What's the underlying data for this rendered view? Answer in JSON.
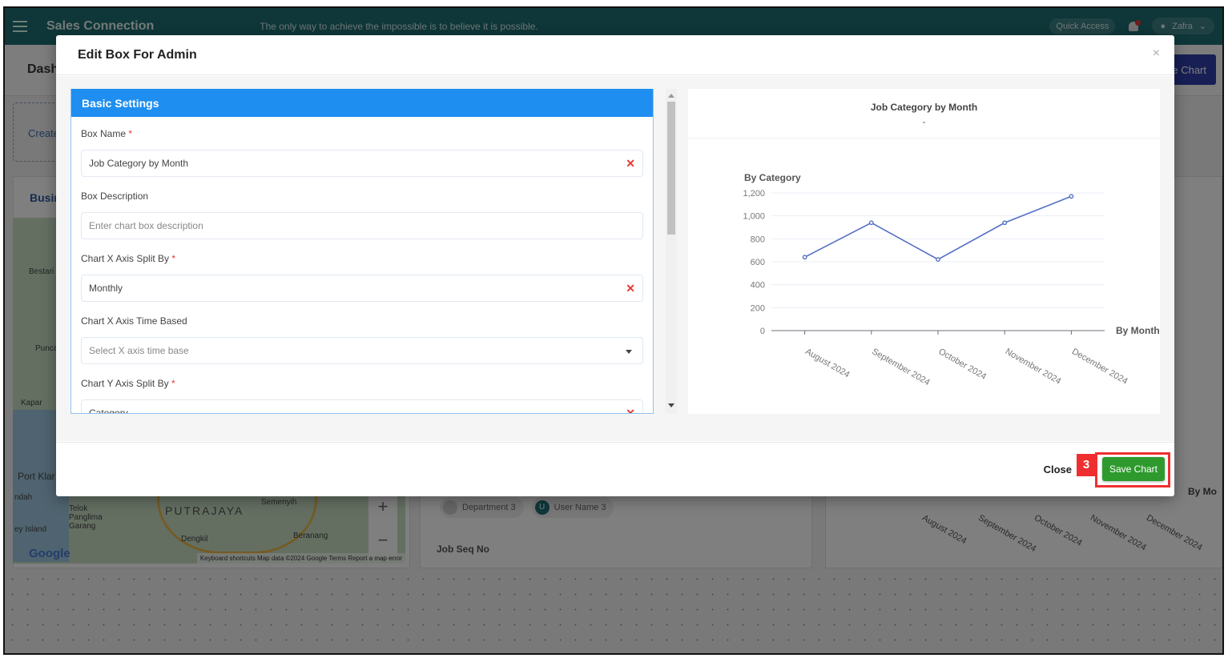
{
  "app": {
    "brand": "Sales Connection",
    "quote": "The only way to achieve the impossible is to believe it is possible.",
    "quick_access": "Quick Access",
    "user_name": "Zafra",
    "page_title": "Dash",
    "create_chart_button": "e Chart",
    "create_box": "Create",
    "business_panel_title": "Busine",
    "map_labels": [
      "Bestari J",
      "Punca",
      "Kapar",
      "Port Klar",
      "ndah",
      "Telok Panglima Garang",
      "PUTRAJAYA",
      "Dengkil",
      "Beranang",
      "Semenyih",
      "ey Island"
    ],
    "map_footer": "Keyboard shortcuts   Map data ©2024 Google   Terms   Report a map error",
    "google": "Google",
    "chips": [
      "Department 3",
      "User Name 3"
    ],
    "user_chip_initial": "U",
    "job_seq_no": "Job Seq No",
    "bg_chart_axis": [
      "August 2024",
      "September 2024",
      "October 2024",
      "November 2024",
      "December 2024"
    ],
    "bg_chart_xlabel": "By Mo"
  },
  "modal": {
    "title": "Edit Box For Admin",
    "close_icon": "×",
    "section_title": "Basic Settings",
    "fields": [
      {
        "label": "Box Name",
        "required": true,
        "value": "Job Category by Month",
        "placeholder": "",
        "control": "clearable"
      },
      {
        "label": "Box Description",
        "required": false,
        "value": "",
        "placeholder": "Enter chart box description",
        "control": "text"
      },
      {
        "label": "Chart X Axis Split By",
        "required": true,
        "value": "Monthly",
        "placeholder": "",
        "control": "clearable"
      },
      {
        "label": "Chart X Axis Time Based",
        "required": false,
        "value": "",
        "placeholder": "Select X axis time base",
        "control": "dropdown"
      },
      {
        "label": "Chart Y Axis Split By",
        "required": true,
        "value": "Category",
        "placeholder": "",
        "control": "clearable"
      }
    ],
    "required_mark": "*",
    "clear_icon": "✕",
    "footer": {
      "close_label": "Close",
      "save_label": "Save Chart",
      "step_badge": "3"
    }
  },
  "chart_data": {
    "type": "line",
    "title": "Job Category by Month",
    "subtitle": "-",
    "xlabel": "By Month",
    "ylabel": "By Category",
    "categories": [
      "August 2024",
      "September 2024",
      "October 2024",
      "November 2024",
      "December 2024"
    ],
    "values": [
      640,
      940,
      620,
      940,
      1170
    ],
    "yticks": [
      0,
      200,
      400,
      600,
      800,
      1000,
      1200
    ],
    "ytick_labels": [
      "0",
      "200",
      "400",
      "600",
      "800",
      "1,000",
      "1,200"
    ],
    "ylim": [
      0,
      1200
    ],
    "grid": true,
    "line_color": "#5470c6"
  }
}
